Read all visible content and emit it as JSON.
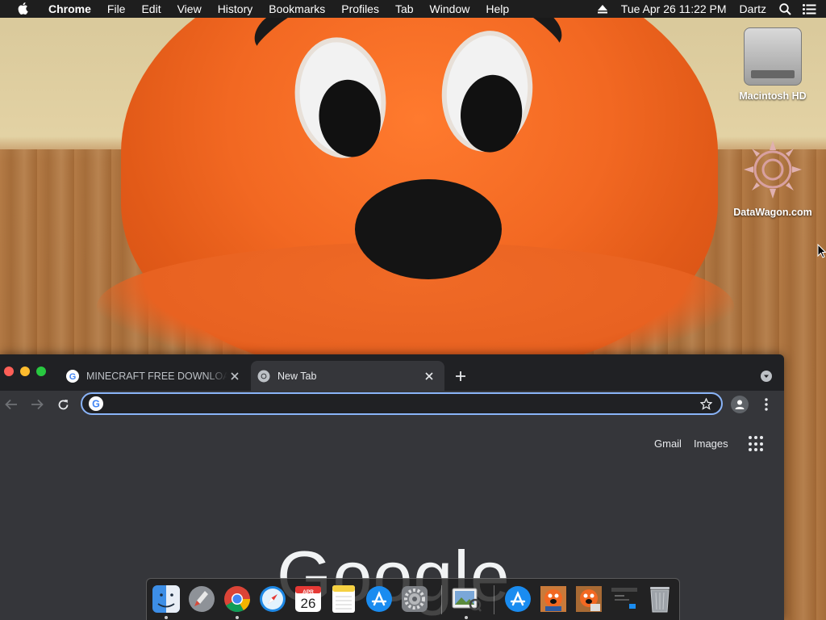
{
  "menubar": {
    "app_name": "Chrome",
    "items": [
      "File",
      "Edit",
      "View",
      "History",
      "Bookmarks",
      "Profiles",
      "Tab",
      "Window",
      "Help"
    ],
    "clock": "Tue Apr 26  11:22 PM",
    "user": "Dartz"
  },
  "desktop": {
    "icons": [
      {
        "label": "Macintosh HD",
        "icon": "hard-drive-icon"
      },
      {
        "label": "DataWagon.com",
        "icon": "datawagon-icon"
      }
    ]
  },
  "browser": {
    "tabs": [
      {
        "title": "MINECRAFT FREE DOWNLOAD",
        "active": false,
        "icon": "google-favicon"
      },
      {
        "title": "New Tab",
        "active": true,
        "icon": "chrome-favicon"
      }
    ],
    "omnibox": {
      "value": "",
      "placeholder": ""
    },
    "ntp": {
      "gmail_label": "Gmail",
      "images_label": "Images",
      "logo_text": "Google"
    }
  },
  "dock": {
    "calendar": {
      "month": "APR",
      "day": "26"
    },
    "items": [
      "Finder",
      "Launchpad",
      "Google Chrome",
      "Safari",
      "Calendar",
      "Notes",
      "App Store",
      "System Preferences",
      "Preview",
      "App Store",
      "Image",
      "Image",
      "Screenshot",
      "Trash"
    ]
  },
  "colors": {
    "menubar": "#1e1e1e",
    "tabstrip": "#202124",
    "toolbar": "#35363a",
    "omnibox_focus": "#8ab4f8",
    "mascot_orange": "#f26822"
  }
}
